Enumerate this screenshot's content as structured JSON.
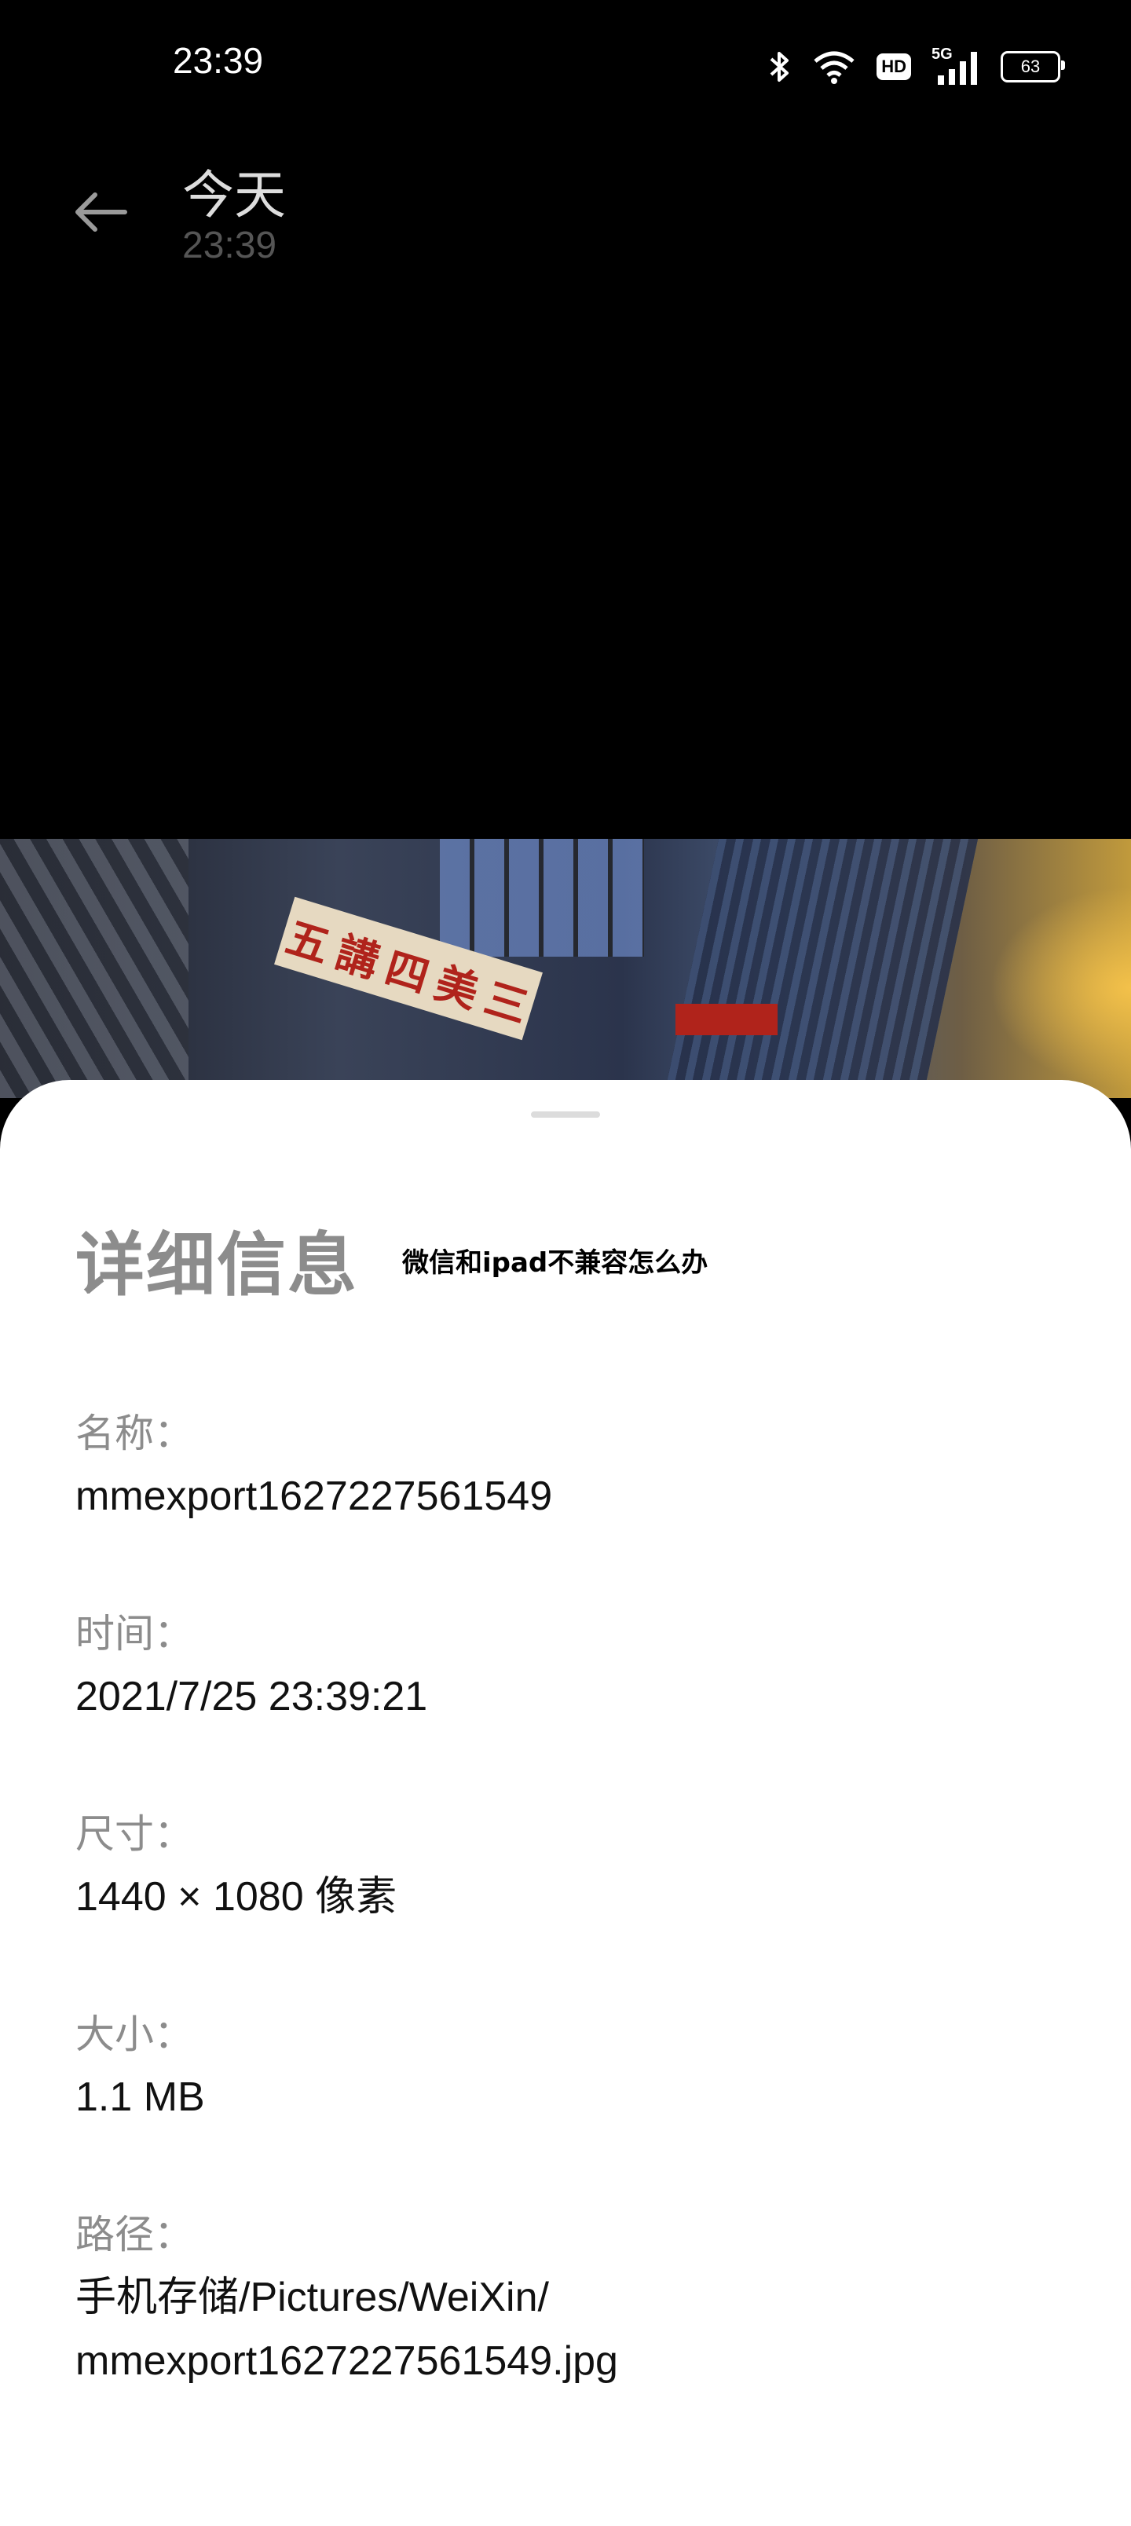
{
  "status_bar": {
    "time": "23:39",
    "icons": [
      "bluetooth-icon",
      "wifi-icon",
      "hd-icon",
      "5g-signal-icon",
      "battery-icon"
    ],
    "hd_label": "HD",
    "network_label": "5G",
    "battery_level": "63"
  },
  "header": {
    "title": "今天",
    "subtitle": "23:39"
  },
  "photo": {
    "sign_chars": [
      "五",
      "講",
      "四",
      "美",
      "三"
    ]
  },
  "sheet": {
    "title": "详细信息",
    "watermark": "微信和ipad不兼容怎么办",
    "fields": [
      {
        "label": "名称：",
        "value": "mmexport1627227561549"
      },
      {
        "label": "时间：",
        "value": "2021/7/25 23:39:21"
      },
      {
        "label": "尺寸：",
        "value": "1440 × 1080 像素"
      },
      {
        "label": "大小：",
        "value": "1.1 MB"
      },
      {
        "label": "路径：",
        "value": "手机存储/Pictures/WeiXin/\nmmexport1627227561549.jpg"
      }
    ]
  }
}
